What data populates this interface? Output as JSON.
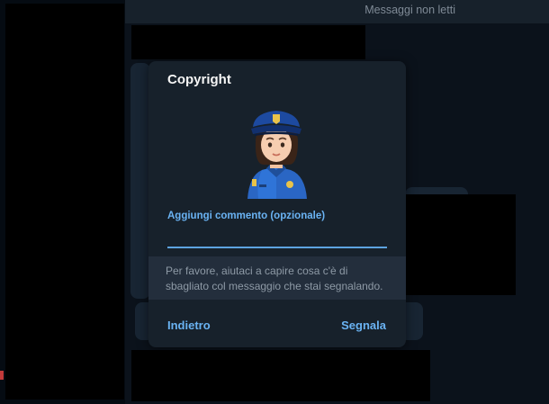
{
  "header": {
    "title": "Messaggi non letti"
  },
  "dialog": {
    "title": "Copyright",
    "emoji_icon": "police-officer-woman-icon",
    "comment_label": "Aggiungi commento (opzionale)",
    "comment_value": "",
    "hint": "Per favore, aiutaci a capire cosa c'è di sbagliato col messaggio che stai segnalando.",
    "back_label": "Indietro",
    "report_label": "Segnala"
  },
  "colors": {
    "accent": "#6ab3f3",
    "dialog_bg": "#17212b",
    "hint_bg": "#232e3c"
  }
}
